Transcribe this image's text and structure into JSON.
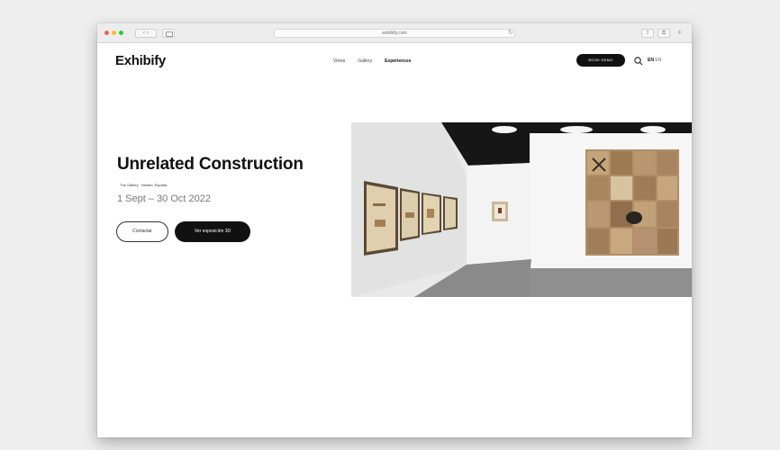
{
  "browser": {
    "url": "exhibify.com",
    "nav_arrows": "‹ ›",
    "reload_icon": "↻",
    "share_icon": "⇪",
    "tabs_icon": "⧉",
    "new_tab_icon": "+"
  },
  "header": {
    "logo": "Exhibify",
    "nav": [
      "Views",
      "Gallery",
      "Experiences"
    ],
    "active_nav": "Experiences",
    "cta_label": "BOOK DEMO",
    "lang_active": "EN",
    "lang_other": "EN"
  },
  "hero": {
    "title": "Unrelated Construction",
    "subtitle": "The Gallery · Madrid, España",
    "dates": "1 Sept – 30 Oct 2022",
    "secondary_button": "Contactar",
    "primary_button": "Ver exposición 3D"
  },
  "colors": {
    "accent": "#111111",
    "background": "#eeeeee",
    "gallery_floor": "#8a8a8a",
    "gallery_ceiling": "#161616"
  }
}
